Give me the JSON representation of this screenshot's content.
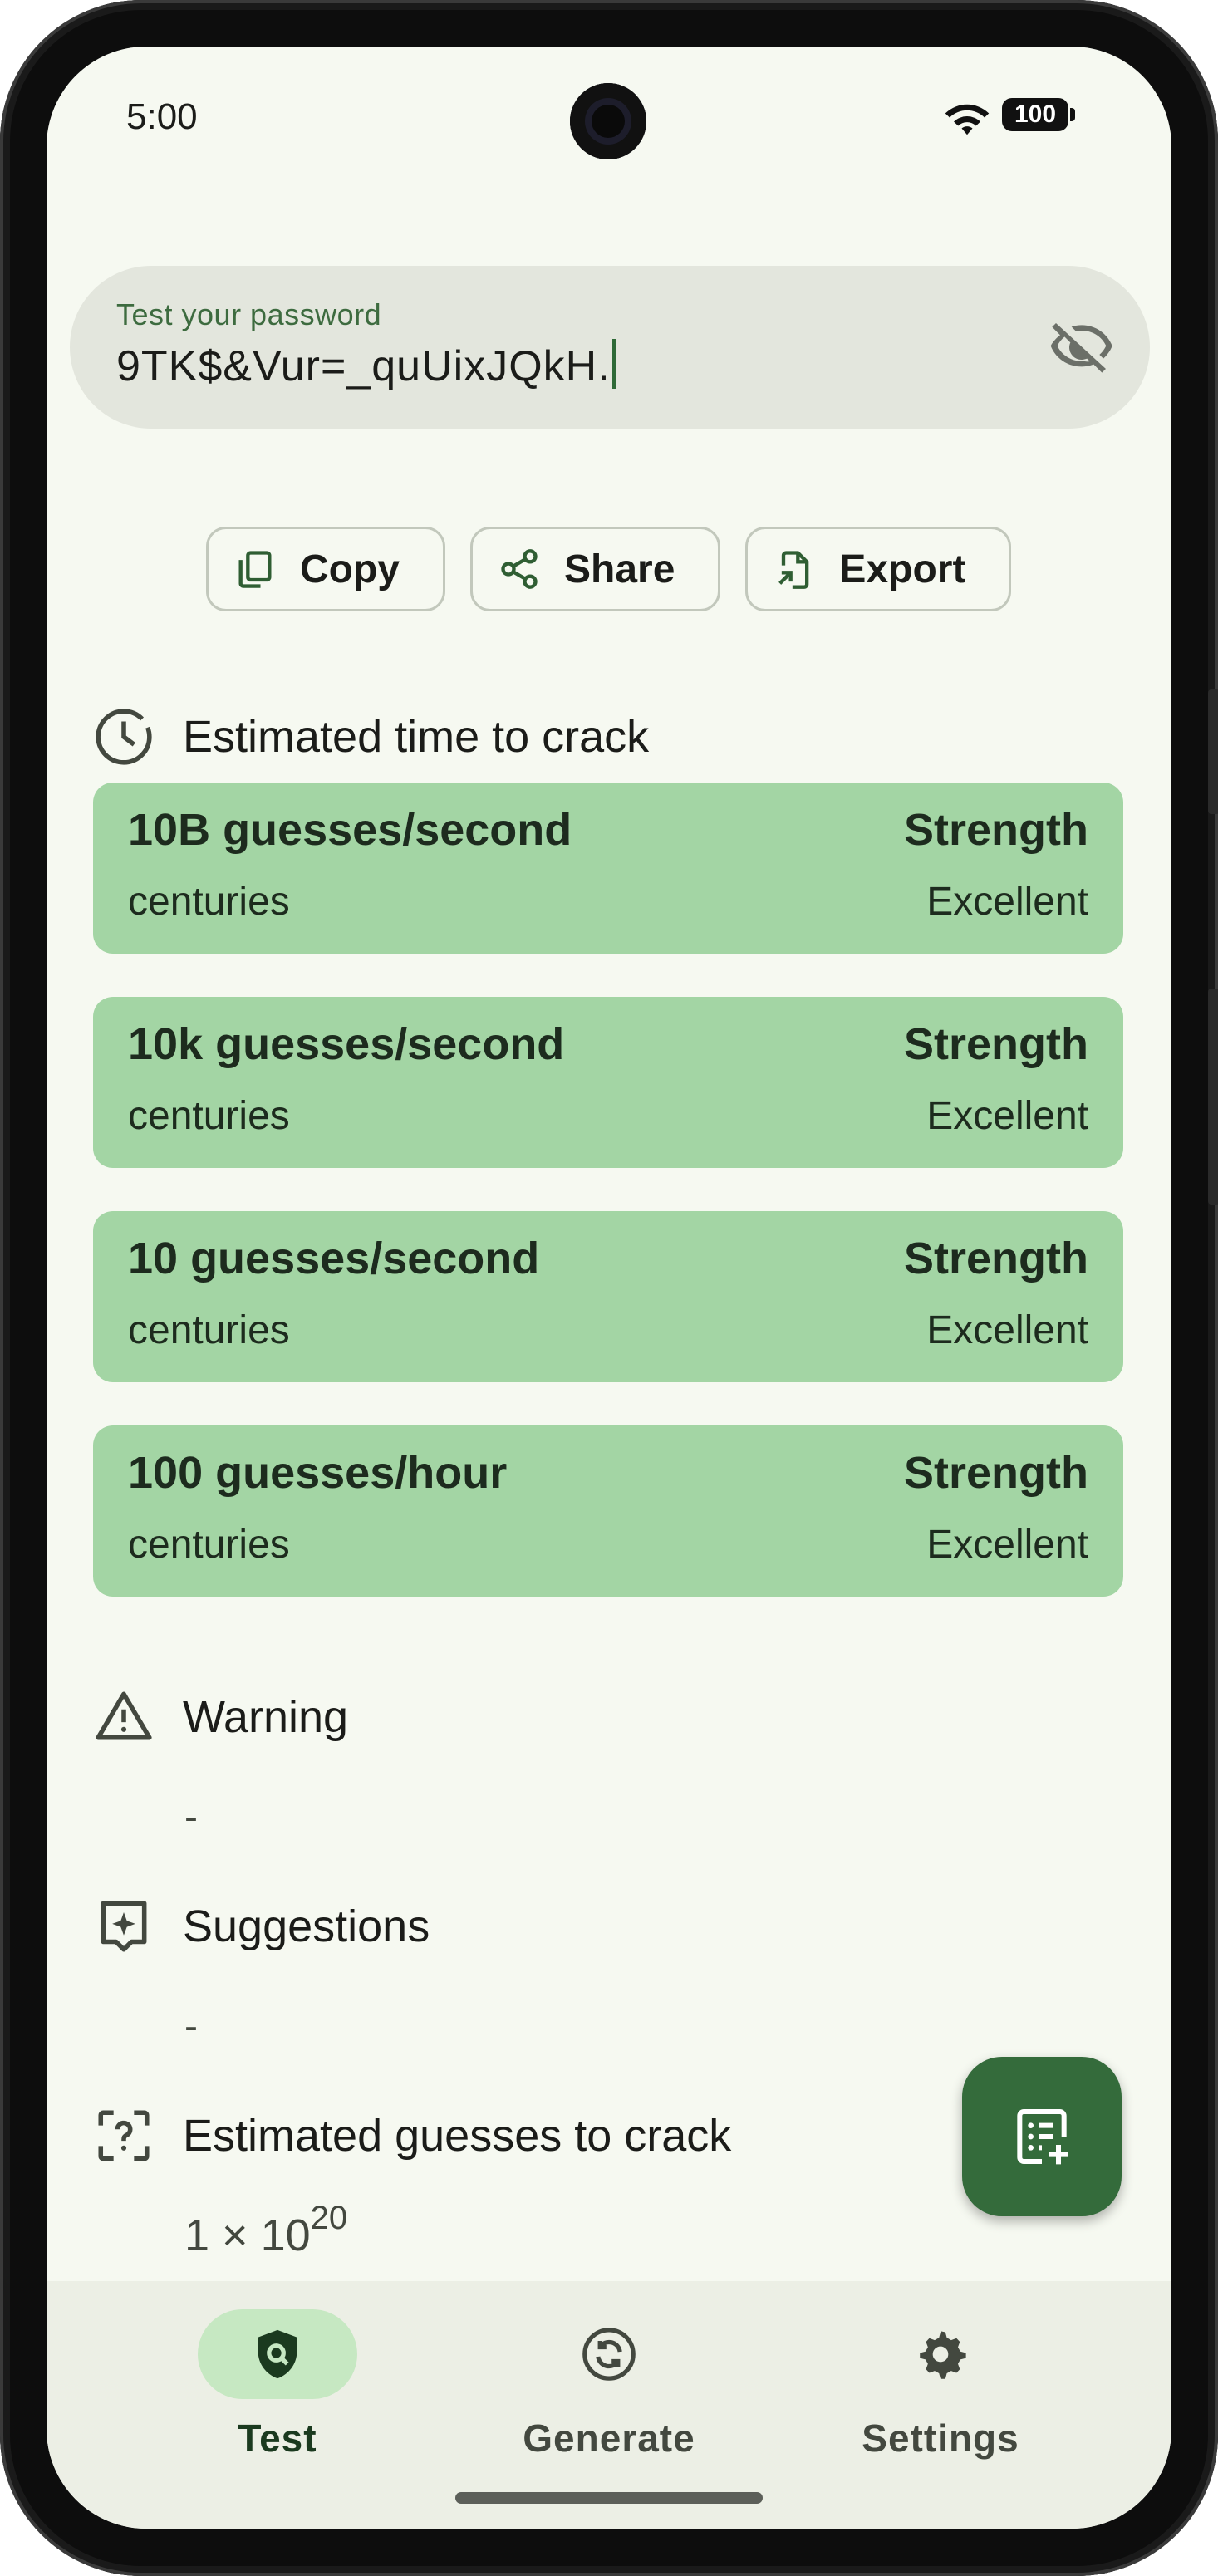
{
  "status_bar": {
    "time": "5:00",
    "battery": "100",
    "icons": [
      "wifi-icon",
      "battery-icon"
    ]
  },
  "password_field": {
    "label": "Test your password",
    "value": "9TK$&Vur=_quUixJQkH.",
    "visibility_icon": "eye-off-icon"
  },
  "actions": [
    {
      "label": "Copy",
      "icon": "copy-icon"
    },
    {
      "label": "Share",
      "icon": "share-icon"
    },
    {
      "label": "Export",
      "icon": "export-icon"
    }
  ],
  "crack_time": {
    "title": "Estimated time to crack",
    "icon": "clock-icon",
    "cards": [
      {
        "rate": "10B guesses/second",
        "time": "centuries",
        "strength_label": "Strength",
        "strength": "Excellent"
      },
      {
        "rate": "10k guesses/second",
        "time": "centuries",
        "strength_label": "Strength",
        "strength": "Excellent"
      },
      {
        "rate": "10 guesses/second",
        "time": "centuries",
        "strength_label": "Strength",
        "strength": "Excellent"
      },
      {
        "rate": "100 guesses/hour",
        "time": "centuries",
        "strength_label": "Strength",
        "strength": "Excellent"
      }
    ]
  },
  "warning": {
    "title": "Warning",
    "value": "-",
    "icon": "warning-icon"
  },
  "suggestions": {
    "title": "Suggestions",
    "value": "-",
    "icon": "suggestion-icon"
  },
  "guesses": {
    "title": "Estimated guesses to crack",
    "mantissa": "1 × 10",
    "exponent": "20",
    "icon": "question-frame-icon"
  },
  "fab": {
    "icon": "add-note-icon"
  },
  "nav": {
    "items": [
      {
        "label": "Test",
        "icon": "shield-search-icon",
        "active": true
      },
      {
        "label": "Generate",
        "icon": "refresh-icon",
        "active": false
      },
      {
        "label": "Settings",
        "icon": "gear-icon",
        "active": false
      }
    ]
  },
  "colors": {
    "card": "#a3d5a4",
    "accent": "#346b3b",
    "background": "#f6f9f1"
  }
}
